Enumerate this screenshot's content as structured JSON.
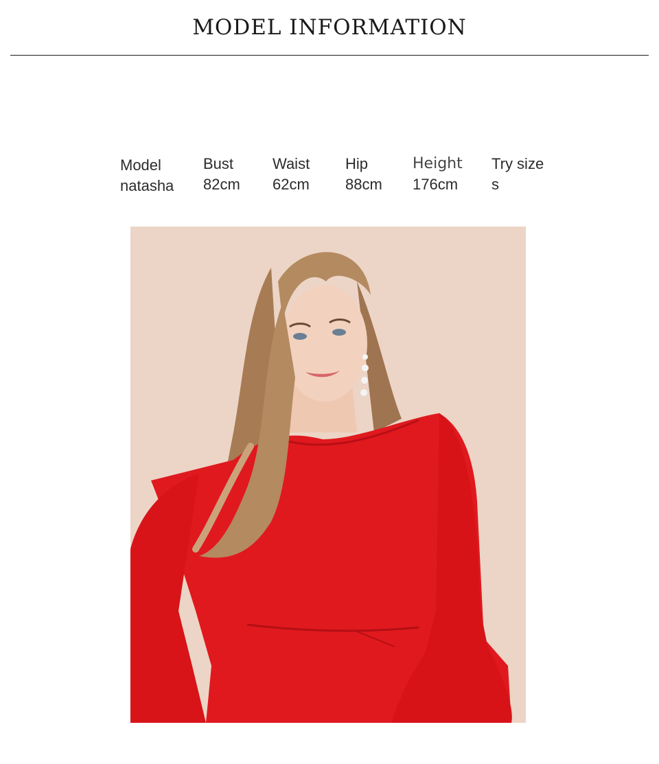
{
  "section": {
    "title": "MODEL INFORMATION"
  },
  "stats": [
    {
      "key": "Model",
      "value": "natasha"
    },
    {
      "key": "Bust",
      "value": "82cm"
    },
    {
      "key": "Waist",
      "value": "62cm"
    },
    {
      "key": "Hip",
      "value": "88cm"
    },
    {
      "key": "Height",
      "value": "176cm"
    },
    {
      "key": "Try size",
      "value": "s"
    }
  ],
  "colors": {
    "background": "#ffffff",
    "photo_backdrop": "#ecd5c6",
    "dress": "#e0191f",
    "hair": "#b48a60",
    "skin": "#f2d2be"
  }
}
